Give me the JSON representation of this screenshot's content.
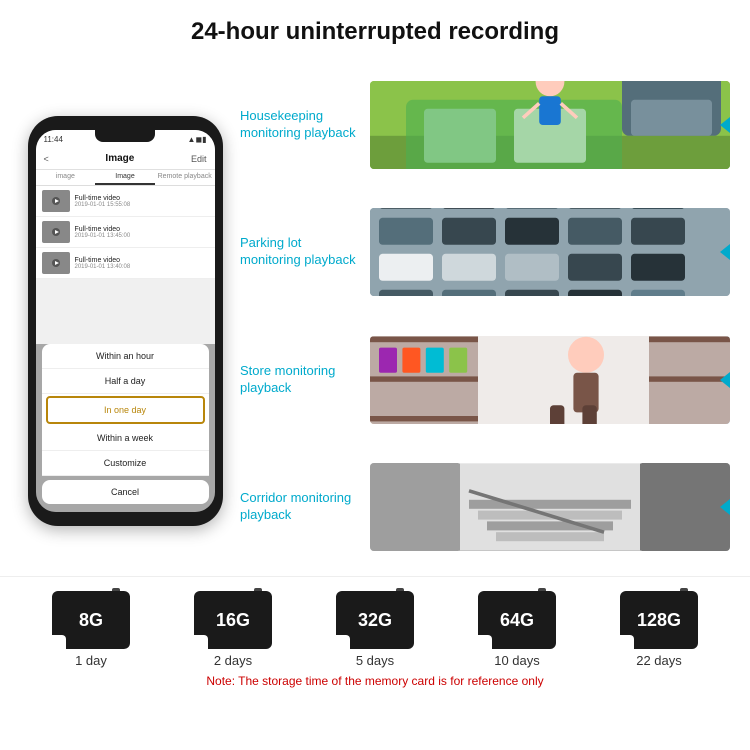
{
  "header": {
    "title": "24-hour uninterrupted recording"
  },
  "phone": {
    "time": "11:44",
    "screen_title": "Image",
    "nav_left": "<",
    "nav_right": "Edit",
    "tabs": [
      "image",
      "Image",
      "Remote playback"
    ],
    "list_items": [
      {
        "title": "Full-time video",
        "date": "2019-01-01 15:55:08"
      },
      {
        "title": "Full-time video",
        "date": "2019-01-01 13:45:00"
      },
      {
        "title": "Full-time video",
        "date": "2019-01-01 13:40:08"
      }
    ],
    "dropdown_items": [
      "Within an hour",
      "Half a day",
      "In one day",
      "Within a week",
      "Customize"
    ],
    "cancel_label": "Cancel"
  },
  "scenarios": [
    {
      "label": "Housekeeping monitoring playback",
      "id": "housekeeping"
    },
    {
      "label": "Parking lot monitoring playback",
      "id": "parking"
    },
    {
      "label": "Store monitoring playback",
      "id": "store"
    },
    {
      "label": "Corridor monitoring playback",
      "id": "corridor"
    }
  ],
  "sd_cards": [
    {
      "size": "8G",
      "days": "1 day"
    },
    {
      "size": "16G",
      "days": "2 days"
    },
    {
      "size": "32G",
      "days": "5 days"
    },
    {
      "size": "64G",
      "days": "10 days"
    },
    {
      "size": "128G",
      "days": "22 days"
    }
  ],
  "sd_note": "Note: The storage time of the memory card is for reference only",
  "colors": {
    "accent_blue": "#00aacc",
    "accent_red": "#cc0000",
    "phone_bg": "#1a1a1a"
  }
}
